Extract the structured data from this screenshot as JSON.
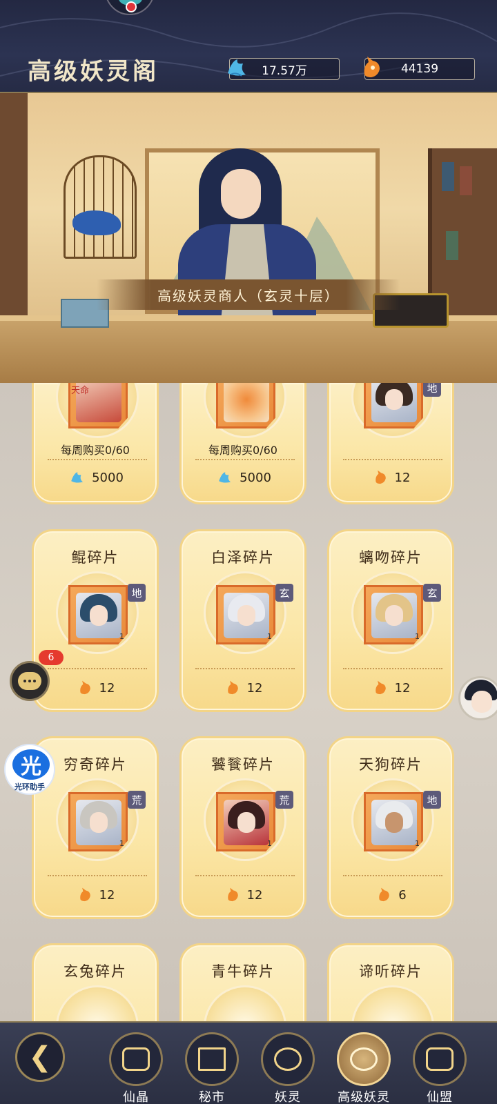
{
  "header": {
    "title": "高级妖灵阁",
    "currency_jade": "17.57万",
    "currency_fox": "44139"
  },
  "scene": {
    "merchant_banner": "高级妖灵商人（玄灵十层）"
  },
  "shop": {
    "top_row": [
      {
        "badge": "天命",
        "limit": "每周购买0/60",
        "price": "5000",
        "currency": "jade-icon",
        "qty": "1"
      },
      {
        "badge": "",
        "limit": "每周购买0/60",
        "price": "5000",
        "currency": "jade-icon",
        "qty": "1"
      },
      {
        "badge": "地",
        "limit": "",
        "price": "12",
        "currency": "fox-icon",
        "qty": "1"
      }
    ],
    "cards": [
      {
        "name": "鲲碎片",
        "grade": "地",
        "qty": "1",
        "price": "12"
      },
      {
        "name": "白泽碎片",
        "grade": "玄",
        "qty": "1",
        "price": "12"
      },
      {
        "name": "螭吻碎片",
        "grade": "玄",
        "qty": "1",
        "price": "12"
      },
      {
        "name": "穷奇碎片",
        "grade": "荒",
        "qty": "1",
        "price": "12"
      },
      {
        "name": "饕餮碎片",
        "grade": "荒",
        "qty": "1",
        "price": "12"
      },
      {
        "name": "天狗碎片",
        "grade": "地",
        "qty": "1",
        "price": "6"
      },
      {
        "name": "玄兔碎片"
      },
      {
        "name": "青牛碎片"
      },
      {
        "name": "谛听碎片"
      }
    ]
  },
  "floating": {
    "chat_badge": "6",
    "helper_logo": "光",
    "helper_label": "光环助手"
  },
  "nav": {
    "items": [
      "仙晶",
      "秘市",
      "妖灵",
      "高级妖灵",
      "仙盟"
    ]
  }
}
